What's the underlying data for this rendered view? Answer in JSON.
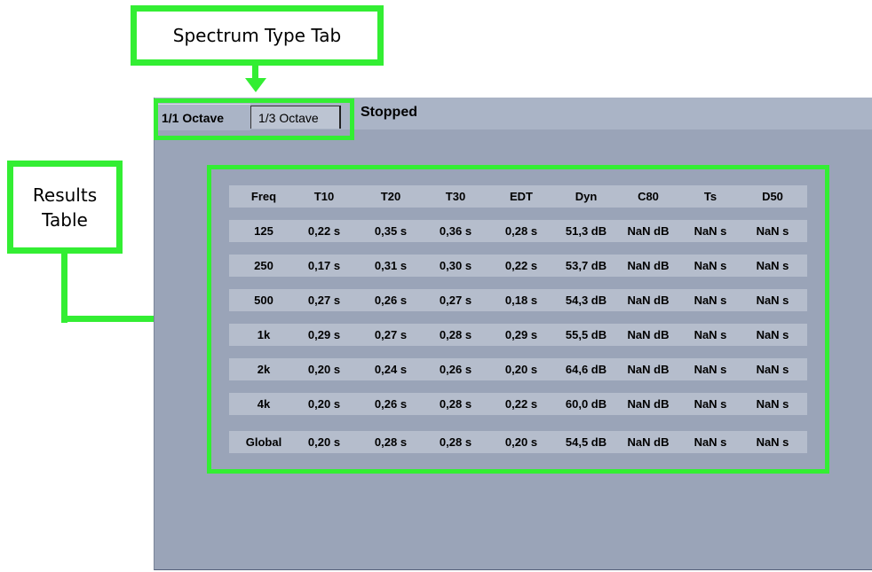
{
  "callouts": {
    "spectrum_tab": "Spectrum Type Tab",
    "results_table_line1": "Results",
    "results_table_line2": "Table"
  },
  "tabs": [
    {
      "label": "1/1 Octave",
      "active": true
    },
    {
      "label": "1/3 Octave",
      "active": false
    }
  ],
  "status": "Stopped",
  "table": {
    "headers": [
      "Freq",
      "T10",
      "T20",
      "T30",
      "EDT",
      "Dyn",
      "C80",
      "Ts",
      "D50"
    ],
    "rows": [
      [
        "125",
        "0,22 s",
        "0,35 s",
        "0,36 s",
        "0,28 s",
        "51,3 dB",
        "NaN dB",
        "NaN s",
        "NaN s"
      ],
      [
        "250",
        "0,17 s",
        "0,31 s",
        "0,30 s",
        "0,22 s",
        "53,7 dB",
        "NaN dB",
        "NaN s",
        "NaN s"
      ],
      [
        "500",
        "0,27 s",
        "0,26 s",
        "0,27 s",
        "0,18 s",
        "54,3 dB",
        "NaN dB",
        "NaN s",
        "NaN s"
      ],
      [
        "1k",
        "0,29 s",
        "0,27 s",
        "0,28 s",
        "0,29 s",
        "55,5 dB",
        "NaN dB",
        "NaN s",
        "NaN s"
      ],
      [
        "2k",
        "0,20 s",
        "0,24 s",
        "0,26 s",
        "0,20 s",
        "64,6 dB",
        "NaN dB",
        "NaN s",
        "NaN s"
      ],
      [
        "4k",
        "0,20 s",
        "0,26 s",
        "0,28 s",
        "0,22 s",
        "60,0 dB",
        "NaN dB",
        "NaN s",
        "NaN s"
      ],
      [
        "Global",
        "0,20 s",
        "0,28 s",
        "0,28 s",
        "0,20 s",
        "54,5 dB",
        "NaN dB",
        "NaN s",
        "NaN s"
      ]
    ]
  },
  "colors": {
    "highlight": "#33ee33",
    "panel_bg": "#9aa4b8",
    "row_bg": "#b5bdcc"
  }
}
